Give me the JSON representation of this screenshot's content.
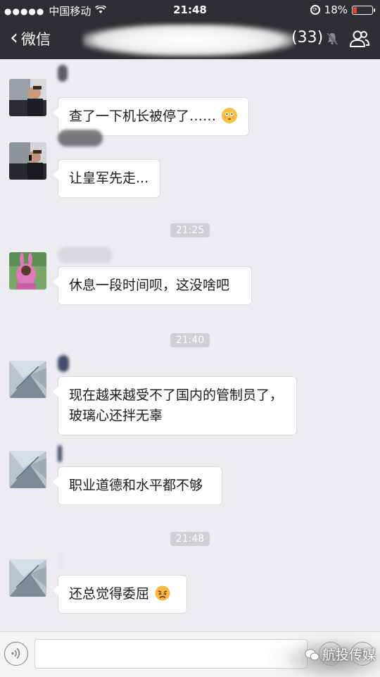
{
  "status_bar": {
    "carrier": "中国移动",
    "time": "21:48",
    "battery_percent": "18%",
    "battery_level": 0.18,
    "battery_color": "#e5432f"
  },
  "nav": {
    "back_label": "微信",
    "member_count": "(33)",
    "icons": [
      "back-chevron-icon",
      "mute-icon",
      "group-members-icon"
    ]
  },
  "messages": [
    {
      "type": "text",
      "text": "查了一下机长被停了……",
      "emoji": "flushed-face"
    },
    {
      "type": "text",
      "text": "让皇军先走..."
    },
    {
      "type": "time",
      "text": "21:25"
    },
    {
      "type": "text",
      "text": "休息一段时间呗，这没啥吧"
    },
    {
      "type": "time",
      "text": "21:40"
    },
    {
      "type": "text",
      "text": "现在越来越受不了国内的管制员了，玻璃心还拌无辜"
    },
    {
      "type": "text",
      "text": "职业道德和水平都不够"
    },
    {
      "type": "time",
      "text": "21:48"
    },
    {
      "type": "text",
      "text": "还总觉得委屈",
      "emoji": "frowning-face"
    }
  ],
  "input_bar": {
    "icons": [
      "voice-icon",
      "emoji-icon",
      "plus-icon"
    ],
    "watermark": "航投传媒"
  },
  "colors": {
    "header_bg": "#2e2e33",
    "chat_bg": "#ececf1",
    "bubble_bg": "#ffffff",
    "timestamp_bg": "#cfcfd4"
  }
}
